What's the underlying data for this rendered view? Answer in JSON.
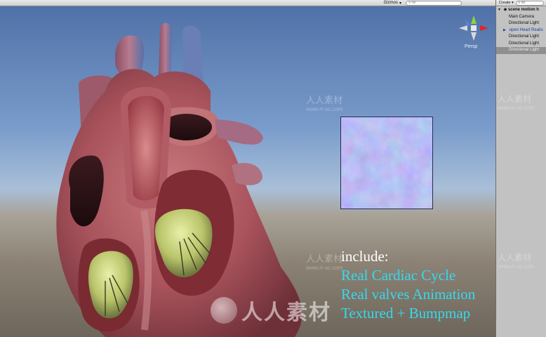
{
  "toolbar": {
    "gizmos_label": "Gizmos",
    "gizmos_arrow": "▾",
    "search_placeholder": "All"
  },
  "viewport": {
    "projection_label": "Persp"
  },
  "caption": {
    "heading": "include:",
    "features": [
      "Real Cardiac Cycle",
      "Real valves Animation",
      "Textured + Bumpmap"
    ],
    "heading_color": "#ffffff",
    "feature_color": "#35d9ef"
  },
  "hierarchy": {
    "create_label": "Create",
    "create_arrow": "▾",
    "search_placeholder": "All",
    "scene_name": "scene motion h",
    "items": [
      "Main Camera",
      "Directional Light",
      "open Heart Realis",
      "Directional Light",
      "Directional Light",
      "Directional Light"
    ]
  },
  "watermarks": {
    "text": "人人素材",
    "url": "www.rr-sc.com",
    "logo_text": "人人素材"
  },
  "colors": {
    "sky_top": "#4d6fa6",
    "ground": "#8b8275",
    "heart_muscle": "#b8606a",
    "valve": "#c8d27a",
    "selection": "#8f8f8f"
  },
  "icons": {
    "scene_icon": "unity-scene-icon",
    "gizmo": "scene-orientation-gizmo",
    "search": "search-icon"
  }
}
